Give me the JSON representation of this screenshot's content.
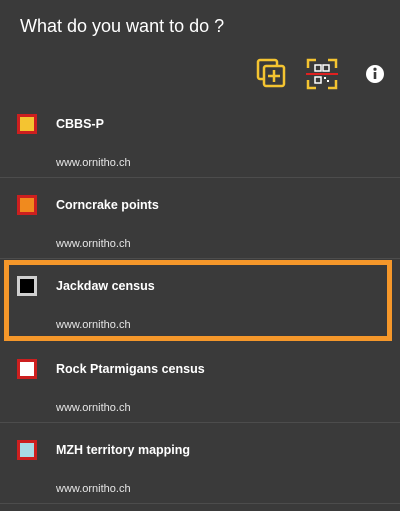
{
  "header": {
    "title": "What do you want to do ?"
  },
  "toolbar": {
    "accent": "#f4c431",
    "buttons": [
      {
        "icon": "add-copy-icon"
      },
      {
        "icon": "qr-scan-icon"
      },
      {
        "icon": "info-icon"
      }
    ]
  },
  "colors": {
    "border": "#cc1f1f",
    "highlight": "#f5972a",
    "background": "#3a3a3a"
  },
  "items": [
    {
      "name": "CBBS-P",
      "site": "www.ornitho.ch",
      "inner_color": "#f4c431",
      "selected": false
    },
    {
      "name": "Corncrake points",
      "site": "www.ornitho.ch",
      "inner_color": "#f08a1e",
      "selected": false
    },
    {
      "name": "Jackdaw census",
      "site": "www.ornitho.ch",
      "inner_color": "#000000",
      "selected": true
    },
    {
      "name": "Rock Ptarmigans census",
      "site": "www.ornitho.ch",
      "inner_color": "#ffffff",
      "selected": false
    },
    {
      "name": "MZH territory mapping",
      "site": "www.ornitho.ch",
      "inner_color": "#a7dbe6",
      "selected": false
    }
  ]
}
